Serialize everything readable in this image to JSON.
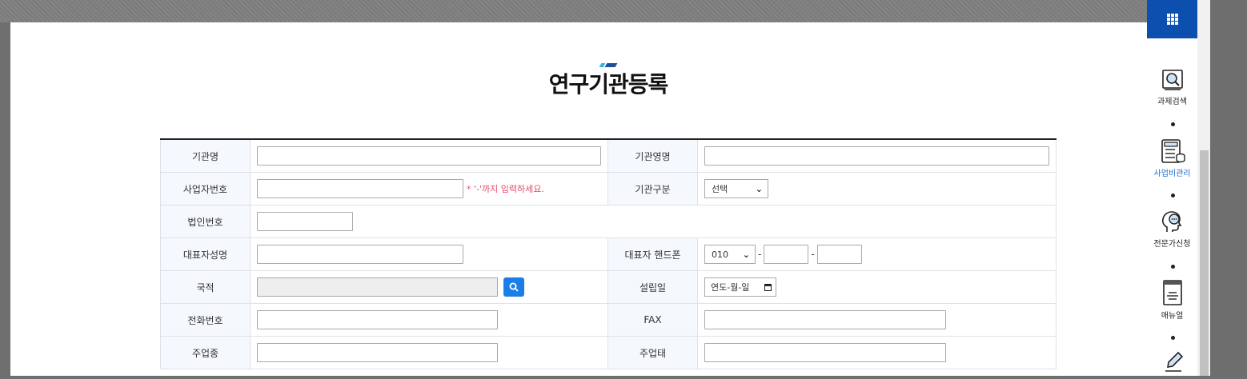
{
  "title": "연구기관등록",
  "form": {
    "org_name_label": "기관명",
    "org_name_value": "",
    "org_name_en_label": "기관영명",
    "org_name_en_value": "",
    "biz_no_label": "사업자번호",
    "biz_no_value": "",
    "biz_no_hint": "* '-'까지 입력하세요.",
    "org_type_label": "기관구분",
    "org_type_selected": "선택",
    "corp_no_label": "법인번호",
    "corp_no_value": "",
    "ceo_name_label": "대표자성명",
    "ceo_name_value": "",
    "ceo_phone_label": "대표자 핸드폰",
    "ceo_phone_prefix": "010",
    "ceo_phone_dash": "-",
    "nationality_label": "국적",
    "nationality_value": "",
    "founded_label": "설립일",
    "founded_placeholder": "연도-월-일",
    "phone_label": "전화번호",
    "phone_value": "",
    "fax_label": "FAX",
    "fax_value": "",
    "industry_label": "주업종",
    "business_type_label": "주업태"
  },
  "quick_menu": {
    "items": [
      {
        "label": "과제검색",
        "icon": "magnifier-document-icon"
      },
      {
        "label": "사업비관리",
        "icon": "calculator-coins-icon"
      },
      {
        "label": "전문가신청",
        "icon": "expert-head-icon"
      },
      {
        "label": "매뉴얼",
        "icon": "manual-book-icon"
      },
      {
        "label": "",
        "icon": "pen-icon"
      }
    ]
  },
  "colors": {
    "accent": "#1a7ee8",
    "quick_top": "#0d4fae",
    "hint": "#e24a6d",
    "active_label": "#1a6fd6"
  }
}
